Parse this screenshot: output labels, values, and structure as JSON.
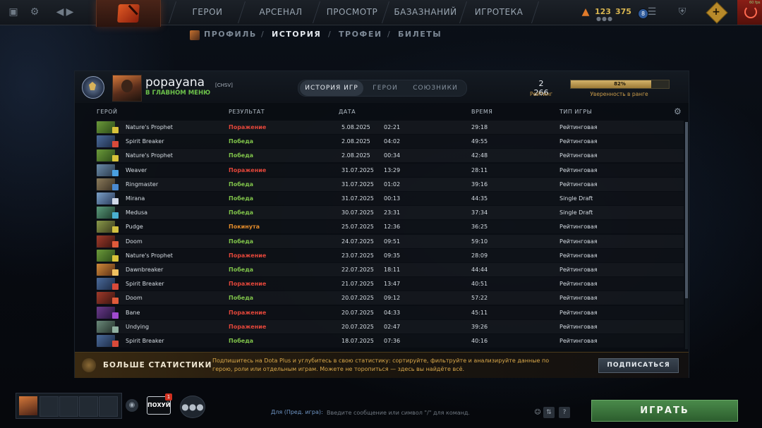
{
  "top_nav": {
    "items": [
      "ГЕРОИ",
      "АРСЕНАЛ",
      "ПРОСМОТР",
      "БАЗАЗНАНИЙ",
      "ИГРОТЕКА"
    ],
    "resource_1": "123",
    "resource_2": "375",
    "notification_count": "8",
    "fps": "60 fps"
  },
  "sub_nav": {
    "items": [
      "ПРОФИЛЬ",
      "ИСТОРИЯ",
      "ТРОФЕИ",
      "БИЛЕТЫ"
    ],
    "active": "ИСТОРИЯ"
  },
  "profile": {
    "username": "popayana",
    "tag": "[CHSV]",
    "status": "В ГЛАВНОМ МЕНЮ",
    "rating_value": "2 266",
    "rating_label": "Рейтинг",
    "confidence_value": "82%",
    "confidence_fraction": 0.82,
    "confidence_label": "Уверенность в ранге"
  },
  "tabs": [
    "ИСТОРИЯ ИГР",
    "ГЕРОИ",
    "СОЮЗНИКИ"
  ],
  "columns": {
    "hero": "ГЕРОЙ",
    "result": "РЕЗУЛЬТАТ",
    "date": "ДАТА",
    "duration": "ВРЕМЯ",
    "game_type": "ТИП ИГРЫ"
  },
  "colors": {
    "loss": "#e2463a",
    "win": "#7fc24a",
    "abandon": "#e08a2a"
  },
  "matches": [
    {
      "hero": "Nature's Prophet",
      "result": "Поражение",
      "date": "5.08.2025",
      "time": "02:21",
      "duration": "29:18",
      "type": "Рейтинговая",
      "outcome": "loss"
    },
    {
      "hero": "Spirit Breaker",
      "result": "Победа",
      "date": "2.08.2025",
      "time": "04:02",
      "duration": "49:55",
      "type": "Рейтинговая",
      "outcome": "win"
    },
    {
      "hero": "Nature's Prophet",
      "result": "Победа",
      "date": "2.08.2025",
      "time": "00:34",
      "duration": "42:48",
      "type": "Рейтинговая",
      "outcome": "win"
    },
    {
      "hero": "Weaver",
      "result": "Поражение",
      "date": "31.07.2025",
      "time": "13:29",
      "duration": "28:11",
      "type": "Рейтинговая",
      "outcome": "loss"
    },
    {
      "hero": "Ringmaster",
      "result": "Победа",
      "date": "31.07.2025",
      "time": "01:02",
      "duration": "39:16",
      "type": "Рейтинговая",
      "outcome": "win"
    },
    {
      "hero": "Mirana",
      "result": "Победа",
      "date": "31.07.2025",
      "time": "00:13",
      "duration": "44:35",
      "type": "Single Draft",
      "outcome": "win"
    },
    {
      "hero": "Medusa",
      "result": "Победа",
      "date": "30.07.2025",
      "time": "23:31",
      "duration": "37:34",
      "type": "Single Draft",
      "outcome": "win"
    },
    {
      "hero": "Pudge",
      "result": "Покинута",
      "date": "25.07.2025",
      "time": "12:36",
      "duration": "36:25",
      "type": "Рейтинговая",
      "outcome": "abandon"
    },
    {
      "hero": "Doom",
      "result": "Победа",
      "date": "24.07.2025",
      "time": "09:51",
      "duration": "59:10",
      "type": "Рейтинговая",
      "outcome": "win"
    },
    {
      "hero": "Nature's Prophet",
      "result": "Поражение",
      "date": "23.07.2025",
      "time": "09:35",
      "duration": "28:09",
      "type": "Рейтинговая",
      "outcome": "loss"
    },
    {
      "hero": "Dawnbreaker",
      "result": "Победа",
      "date": "22.07.2025",
      "time": "18:11",
      "duration": "44:44",
      "type": "Рейтинговая",
      "outcome": "win"
    },
    {
      "hero": "Spirit Breaker",
      "result": "Поражение",
      "date": "21.07.2025",
      "time": "13:47",
      "duration": "40:51",
      "type": "Рейтинговая",
      "outcome": "loss"
    },
    {
      "hero": "Doom",
      "result": "Победа",
      "date": "20.07.2025",
      "time": "09:12",
      "duration": "57:22",
      "type": "Рейтинговая",
      "outcome": "win"
    },
    {
      "hero": "Bane",
      "result": "Поражение",
      "date": "20.07.2025",
      "time": "04:33",
      "duration": "45:11",
      "type": "Рейтинговая",
      "outcome": "loss"
    },
    {
      "hero": "Undying",
      "result": "Поражение",
      "date": "20.07.2025",
      "time": "02:47",
      "duration": "39:26",
      "type": "Рейтинговая",
      "outcome": "loss"
    },
    {
      "hero": "Spirit Breaker",
      "result": "Победа",
      "date": "18.07.2025",
      "time": "07:36",
      "duration": "40:16",
      "type": "Рейтинговая",
      "outcome": "win"
    }
  ],
  "promo": {
    "title": "БОЛЬШЕ СТАТИСТИКИ",
    "text": "Подпишитесь на Dota Plus и углубитесь в свою статистику: сортируйте, фильтруйте и анализируйте данные по герою, роли или отдельным играм. Можете не торопиться — здесь вы найдёте всё.",
    "button": "ПОДПИСАТЬСЯ"
  },
  "bottom": {
    "event_label": "ПОХУЙ",
    "event_badge": "1",
    "chat_target": "Для (Пред. игра):",
    "chat_placeholder": "Введите сообщение или символ \"/\" для команд.",
    "help_label": "?",
    "play_button": "ИГРАТЬ"
  }
}
